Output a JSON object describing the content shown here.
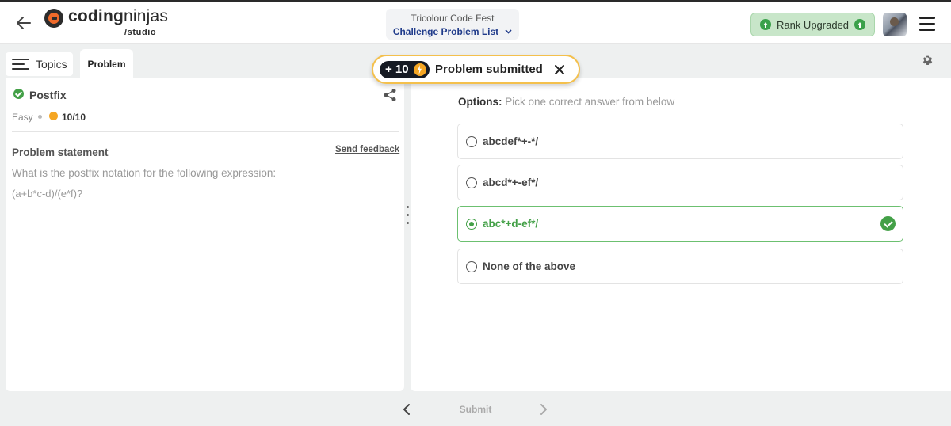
{
  "header": {
    "logo_text_a": "coding",
    "logo_text_b": "ninjas",
    "logo_sub": "/studio",
    "event_title": "Tricolour Code Fest",
    "list_link": "Challenge Problem List",
    "rank_label": "Rank Upgraded"
  },
  "tabs": {
    "topics": "Topics",
    "problem": "Problem"
  },
  "problem": {
    "title": "Postfix",
    "difficulty": "Easy",
    "score": "10/10",
    "statement_label": "Problem statement",
    "feedback_label": "Send feedback",
    "statement": "What is the postfix notation for the following expression:",
    "expression": "(a+b*c-d)/(e*f)?"
  },
  "options": {
    "label_bold": "Options:",
    "label_hint": "Pick one correct answer from below",
    "items": [
      {
        "label": "abcdef*+-*/",
        "selected": false
      },
      {
        "label": "abcd*+-ef*/",
        "selected": false
      },
      {
        "label": "abc*+d-ef*/",
        "selected": true,
        "correct": true
      },
      {
        "label": "None of the above",
        "selected": false
      }
    ]
  },
  "toast": {
    "points": "+ 10",
    "message": "Problem submitted"
  },
  "footer": {
    "submit": "Submit"
  },
  "colors": {
    "accent_green": "#43a047",
    "toast_border": "#f4c04c",
    "link_blue": "#1f3a8a",
    "logo_orange": "#f06a2a"
  }
}
